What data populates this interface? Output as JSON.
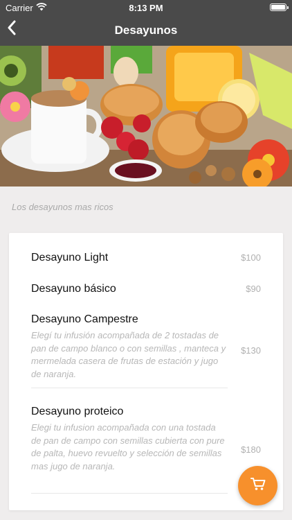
{
  "status_bar": {
    "carrier": "Carrier",
    "time": "8:13 PM"
  },
  "nav": {
    "title": "Desayunos",
    "back_icon": "chevron-left-icon"
  },
  "hero": {
    "image": "breakfast-photo"
  },
  "subtitle": "Los desayunos mas ricos",
  "menu": {
    "items": [
      {
        "name": "Desayuno Light",
        "description": "",
        "price": "$100"
      },
      {
        "name": "Desayuno básico",
        "description": "",
        "price": "$90"
      },
      {
        "name": "Desayuno Campestre",
        "description": "Elegí tu infusión acompañada de 2 tostadas de pan de campo blanco o con semillas , manteca y mermelada casera de frutas de estación y jugo de naranja.",
        "price": "$130"
      },
      {
        "name": "Desayuno proteico",
        "description": "Elegi tu infusion acompañada con una tostada de pan de campo con semillas cubierta con pure de palta, huevo revuelto y selección de semillas mas jugo de naranja.",
        "price": "$180"
      }
    ]
  },
  "cart_button": {
    "icon": "shopping-cart-icon"
  },
  "colors": {
    "nav_bg": "#4a4a4a",
    "accent": "#f7902c",
    "background": "#efeded"
  }
}
